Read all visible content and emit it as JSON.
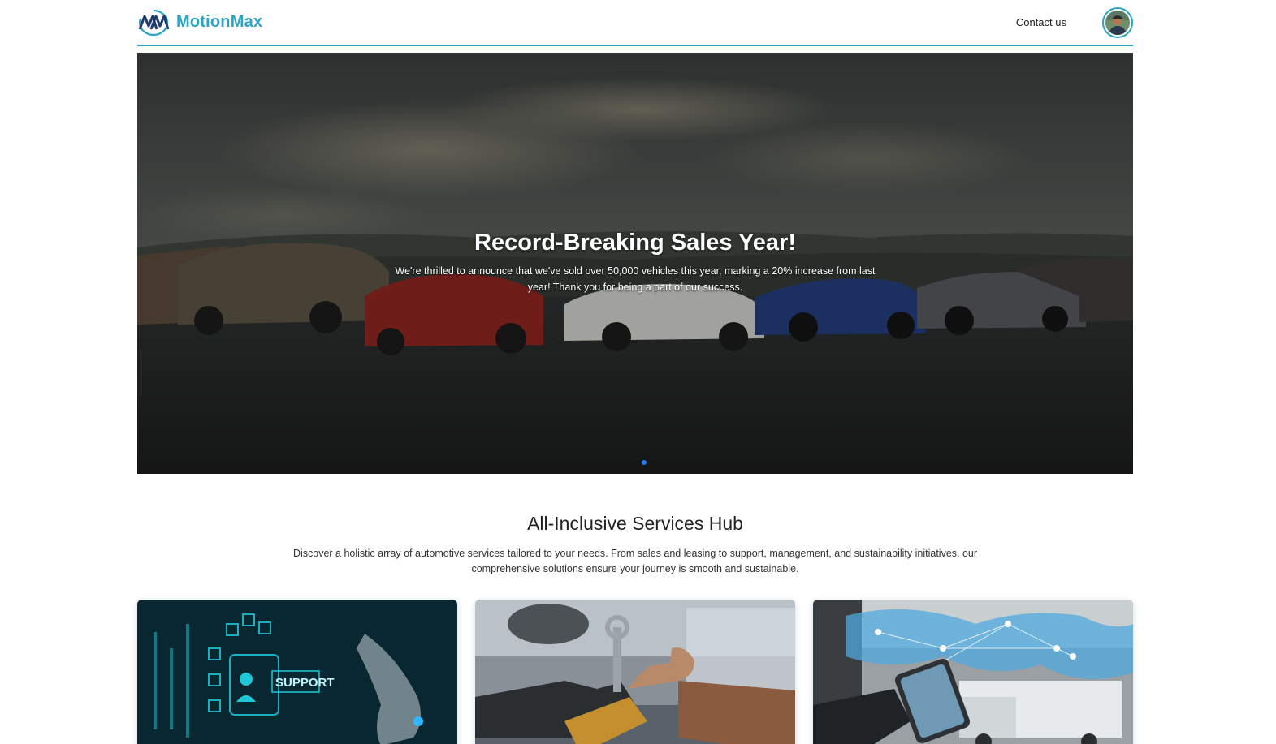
{
  "brand": {
    "name": "MotionMax",
    "logo_icon": "motionmax-logo-icon"
  },
  "nav": {
    "contact_label": "Contact us",
    "avatar_icon": "user-avatar-icon"
  },
  "hero": {
    "title": "Record-Breaking Sales Year!",
    "text": "We're thrilled to announce that we've sold over 50,000 vehicles this year, marking a 20% increase from last year! Thank you for being a part of our success.",
    "active_slide": 1,
    "slide_count": 1
  },
  "services": {
    "title": "All-Inclusive Services Hub",
    "description": "Discover a holistic array of automotive services tailored to your needs. From sales and leasing to support, management, and sustainability initiatives, our comprehensive solutions ensure your journey is smooth and sustainable.",
    "cards": [
      {
        "image": "support-digital-image",
        "sign_text": "SUPPORT"
      },
      {
        "image": "mechanic-thumbs-up-image"
      },
      {
        "image": "logistics-network-image"
      }
    ]
  },
  "colors": {
    "accent": "#2aa3c4",
    "dot_active": "#1a7fff",
    "brand_dark": "#1f3b6e"
  }
}
